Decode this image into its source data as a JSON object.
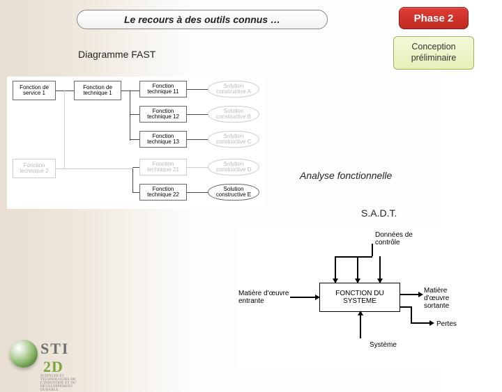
{
  "title": "Le recours à des outils connus …",
  "phase": "Phase 2",
  "concept": "Conception préliminaire",
  "labels": {
    "fast": "Diagramme FAST",
    "af": "Analyse fonctionnelle",
    "sadt": "S.A.D.T."
  },
  "fast_diagram": {
    "col1": [
      "Fonction de\nservice 1",
      "Fonction\ntechnique 2"
    ],
    "col2": [
      "Fonction de technique 1",
      "Fonction technique 11",
      "Fonction technique 12",
      "Fonction technique 13",
      "Fonction technique 21",
      "Fonction technique 22"
    ],
    "col3": [
      "Solution constructive A",
      "Solution constructive B",
      "Solution constructive C",
      "Solution constructive D",
      "Solution constructive E"
    ]
  },
  "sadt_diagram": {
    "center": "FONCTION DU SYSTEME",
    "top": "Données de contrôle",
    "left": "Matière d'œuvre entrante",
    "right": "Matière d'œuvre sortante",
    "bottomRight": "Pertes",
    "bottom": "Système"
  },
  "logo": {
    "brand_a": "STI",
    "brand_b": "2D",
    "sub": "SCIENCES ET TECHNOLOGIES DE L'INDUSTRIE ET DU DÉVELOPPEMENT DURABLE"
  },
  "chart_data": {
    "type": "diagram",
    "note": "Schematic FAST hierarchy and SADT functional block; no quantitative data present."
  }
}
